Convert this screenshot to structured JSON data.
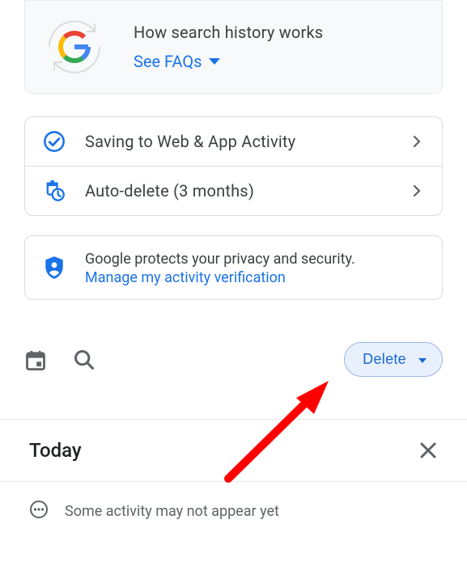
{
  "infoCard": {
    "title": "How search history works",
    "faqLabel": "See FAQs"
  },
  "settings": {
    "savingLabel": "Saving to Web & App Activity",
    "autoDeleteLabel": "Auto-delete (3 months)"
  },
  "privacy": {
    "text": "Google protects your privacy and security.",
    "linkLabel": "Manage my activity verification"
  },
  "toolbar": {
    "deleteLabel": "Delete"
  },
  "today": {
    "title": "Today"
  },
  "note": {
    "text": "Some activity may not appear yet"
  },
  "colors": {
    "linkBlue": "#1a73e8",
    "iconBlue": "#1a73e8",
    "arrowRed": "#ff0000"
  }
}
